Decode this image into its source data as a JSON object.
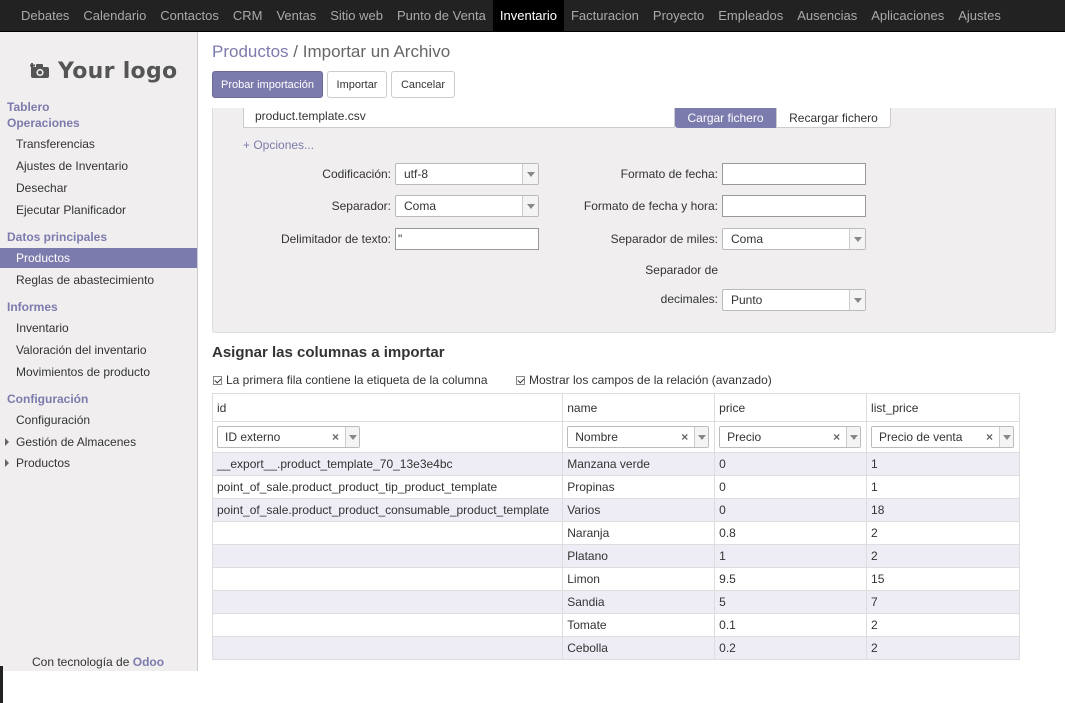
{
  "topbar": {
    "items": [
      "Debates",
      "Calendario",
      "Contactos",
      "CRM",
      "Ventas",
      "Sitio web",
      "Punto de Venta",
      "Inventario",
      "Facturacion",
      "Proyecto",
      "Empleados",
      "Ausencias",
      "Aplicaciones",
      "Ajustes"
    ],
    "active": "Inventario"
  },
  "sidebar": {
    "logo_text": "Your logo",
    "heading_tablero": "Tablero",
    "heading_operaciones": "Operaciones",
    "ops_items": [
      "Transferencias",
      "Ajustes de Inventario",
      "Desechar",
      "Ejecutar Planificador"
    ],
    "heading_datos": "Datos principales",
    "datos_items": [
      "Productos",
      "Reglas de abastecimiento"
    ],
    "heading_informes": "Informes",
    "informes_items": [
      "Inventario",
      "Valoración del inventario",
      "Movimientos de producto"
    ],
    "heading_config": "Configuración",
    "config_items": [
      "Configuración",
      "Gestión de Almacenes",
      "Productos"
    ],
    "powered_prefix": "Con tecnología de",
    "powered_brand": "Odoo"
  },
  "breadcrumb": {
    "parent": "Productos",
    "separator": "/",
    "current": "Importar un Archivo"
  },
  "actions": {
    "test": "Probar importación",
    "import": "Importar",
    "cancel": "Cancelar"
  },
  "file": {
    "name": "product.template.csv",
    "load": "Cargar fichero",
    "reload": "Recargar fichero"
  },
  "options": {
    "link": "+ Opciones...",
    "encoding_label": "Codificación:",
    "encoding_value": "utf-8",
    "separator_label": "Separador:",
    "separator_value": "Coma",
    "text_delim_label": "Delimitador de texto:",
    "text_delim_value": "\"",
    "date_format_label": "Formato de fecha:",
    "date_format_value": "",
    "datetime_format_label": "Formato de fecha y hora:",
    "datetime_format_value": "",
    "thousands_label": "Separador de miles:",
    "thousands_value": "Coma",
    "decimal_label_1": "Separador de",
    "decimal_label_2": "decimales:",
    "decimal_value": "Punto"
  },
  "mapping": {
    "title": "Asignar las columnas a importar",
    "first_row_header": "La primera fila contiene la etiqueta de la columna",
    "show_relation_fields": "Mostrar los campos de la relación (avanzado)",
    "columns": [
      {
        "header": "id",
        "field": "ID externo"
      },
      {
        "header": "name",
        "field": "Nombre"
      },
      {
        "header": "price",
        "field": "Precio"
      },
      {
        "header": "list_price",
        "field": "Precio de venta"
      }
    ],
    "rows": [
      [
        "__export__.product_template_70_13e3e4bc",
        "Manzana verde",
        "0",
        "1"
      ],
      [
        "point_of_sale.product_product_tip_product_template",
        "Propinas",
        "0",
        "1"
      ],
      [
        "point_of_sale.product_product_consumable_product_template",
        "Varios",
        "0",
        "18"
      ],
      [
        "",
        "Naranja",
        "0.8",
        "2"
      ],
      [
        "",
        "Platano",
        "1",
        "2"
      ],
      [
        "",
        "Limon",
        "9.5",
        "15"
      ],
      [
        "",
        "Sandia",
        "5",
        "7"
      ],
      [
        "",
        "Tomate",
        "0.1",
        "2"
      ],
      [
        "",
        "Cebolla",
        "0.2",
        "2"
      ]
    ]
  },
  "colors": {
    "accent": "#7c7bad",
    "topbar": "#222222",
    "sidebar": "#f0eeee",
    "row_stripe": "#eeedf5"
  }
}
